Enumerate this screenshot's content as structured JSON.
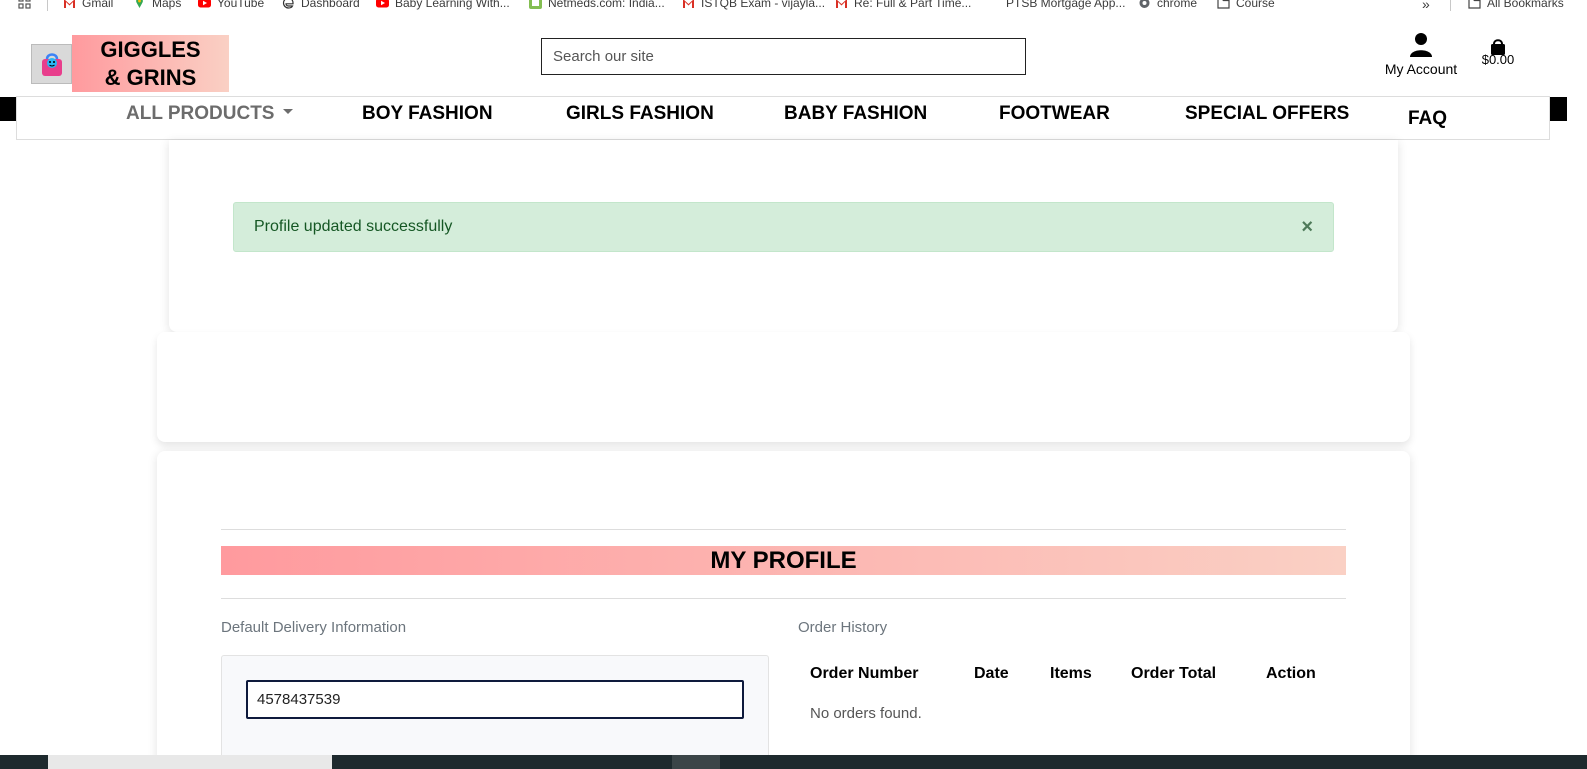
{
  "bookmarks": [
    {
      "label": "Gmail",
      "icon": "gmail-icon"
    },
    {
      "label": "Maps",
      "icon": "maps-icon"
    },
    {
      "label": "YouTube",
      "icon": "youtube-icon"
    },
    {
      "label": "Dashboard",
      "icon": "edge-icon"
    },
    {
      "label": "Baby Learning With...",
      "icon": "youtube-icon"
    },
    {
      "label": "Netmeds.com: India...",
      "icon": "netmeds-icon"
    },
    {
      "label": "ISTQB Exam - vijayla...",
      "icon": "gmail-icon"
    },
    {
      "label": "Re: Full & Part Time...",
      "icon": "gmail-icon"
    },
    {
      "label": "PTSB Mortgage App...",
      "icon": "blank-icon"
    },
    {
      "label": "chrome",
      "icon": "globe-icon"
    },
    {
      "label": "Course",
      "icon": "folder-icon"
    }
  ],
  "bookmarks_more": "»",
  "all_bookmarks": "All Bookmarks",
  "header": {
    "logo_text": "GIGGLES & GRINS",
    "search_placeholder": "Search our site",
    "account_label": "My Account",
    "cart_total": "$0.00"
  },
  "nav": {
    "items": [
      {
        "label": "ALL PRODUCTS",
        "dropdown": true
      },
      {
        "label": "BOY FASHION"
      },
      {
        "label": "GIRLS FASHION"
      },
      {
        "label": "BABY FASHION"
      },
      {
        "label": "FOOTWEAR"
      },
      {
        "label": "SPECIAL OFFERS"
      },
      {
        "label": "FAQ"
      }
    ]
  },
  "alert": {
    "message": "Profile updated successfully",
    "close": "×"
  },
  "profile": {
    "title": "MY PROFILE",
    "delivery_label": "Default Delivery Information",
    "phone_value": "4578437539",
    "order_history_label": "Order History",
    "order_columns": [
      "Order Number",
      "Date",
      "Items",
      "Order Total",
      "Action"
    ],
    "no_orders": "No orders found."
  },
  "colors": {
    "gradient_start": "#ff9a9e",
    "gradient_end": "#fad0c4",
    "alert_bg": "#d4edda",
    "alert_text": "#155724"
  }
}
